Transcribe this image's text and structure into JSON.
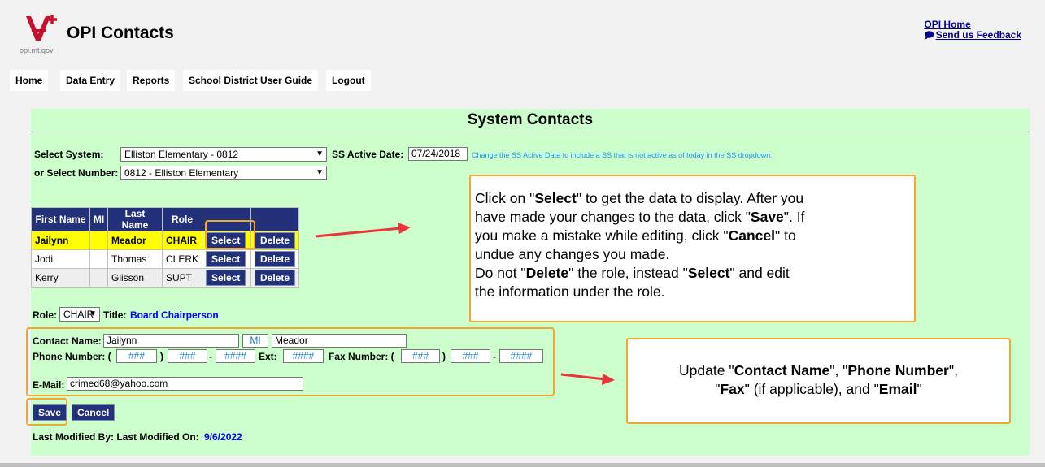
{
  "header": {
    "app_title": "OPI Contacts",
    "logo_caption": "opi.mt.gov",
    "links": {
      "home": "OPI Home",
      "feedback": "Send us Feedback"
    }
  },
  "nav": [
    "Home",
    "Data Entry",
    "Reports",
    "School District User Guide",
    "Logout"
  ],
  "panel": {
    "title": "System Contacts",
    "select_system_label": "Select System:",
    "select_system_value": "Elliston Elementary - 0812",
    "ss_active_date_label": "SS Active Date:",
    "ss_active_date_value": "07/24/2018",
    "ss_active_hint": "Change the SS Active Date to include a SS that is not active as of today in the SS dropdown.",
    "select_number_label": "or Select Number:",
    "select_number_value": "0812 - Elliston Elementary"
  },
  "table": {
    "headers": [
      "First Name",
      "MI",
      "Last Name",
      "Role",
      "",
      ""
    ],
    "rows": [
      {
        "first": "Jailynn",
        "mi": "",
        "last": "Meador",
        "role": "CHAIR",
        "select": "Select",
        "delete": "Delete"
      },
      {
        "first": "Jodi",
        "mi": "",
        "last": "Thomas",
        "role": "CLERK",
        "select": "Select",
        "delete": "Delete"
      },
      {
        "first": "Kerry",
        "mi": "",
        "last": "Glisson",
        "role": "SUPT",
        "select": "Select",
        "delete": "Delete"
      }
    ]
  },
  "role": {
    "label": "Role:",
    "value": "CHAIR",
    "title_label": "Title:",
    "title_value": "Board Chairperson"
  },
  "form": {
    "contact_name_label": "Contact Name:",
    "first_name": "Jailynn",
    "mi_placeholder": "MI",
    "last_name": "Meador",
    "phone_label": "Phone Number: (",
    "paren_close": ")",
    "dash": "-",
    "area_placeholder": "###",
    "prefix_placeholder": "###",
    "line_placeholder": "####",
    "ext_label": "Ext:",
    "ext_placeholder": "####",
    "fax_label": "Fax Number: (",
    "email_label": "E-Mail:",
    "email_value": "crimed68@yahoo.com"
  },
  "buttons": {
    "save": "Save",
    "cancel": "Cancel"
  },
  "last_modified": {
    "label": "Last Modified By: Last Modified On:",
    "date": "9/6/2022"
  },
  "callouts": {
    "select": {
      "line1_pre": "Click on \"",
      "line1_b": "Select",
      "line1_post": "\" to get the data to display. After you",
      "line2_pre": "have made your changes to the data, click \"",
      "line2_b": "Save",
      "line2_post": "\". If",
      "line3_pre": "you make a mistake while editing, click \"",
      "line3_b": "Cancel",
      "line3_post": "\" to",
      "line4": "undue any changes you made.",
      "line5_pre": "Do not \"",
      "line5_b": "Delete",
      "line5_mid": "\" the role, instead \"",
      "line5_b2": "Select",
      "line5_post": "\" and edit",
      "line6": "the information under the role."
    },
    "update": {
      "line1_pre": "Update \"",
      "line1_b1": "Contact Name",
      "line1_mid1": "\", \"",
      "line1_b2": "Phone Number",
      "line1_post": "\",",
      "line2_pre": "\"",
      "line2_b1": "Fax",
      "line2_mid": "\" (if applicable), and \"",
      "line2_b2": "Email",
      "line2_post": "\""
    }
  },
  "colors": {
    "panel": "#ccffcc",
    "header_blue": "#23307a",
    "highlight": "#ffff00",
    "callout_border": "#f0a830",
    "arrow": "#e8363a"
  }
}
